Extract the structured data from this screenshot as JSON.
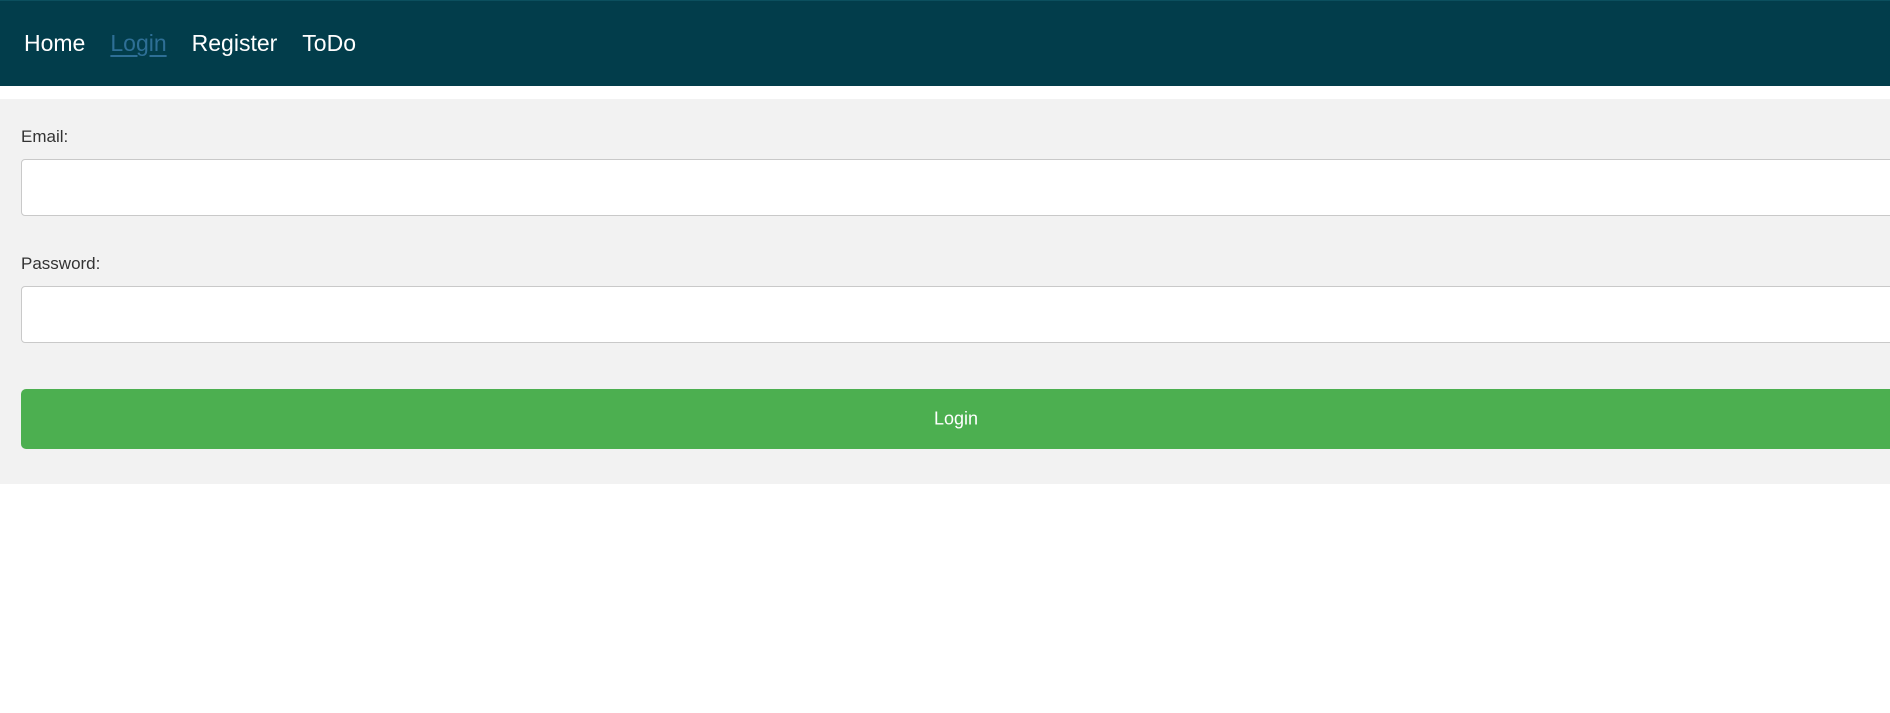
{
  "nav": {
    "items": [
      {
        "label": "Home",
        "active": false
      },
      {
        "label": "Login",
        "active": true
      },
      {
        "label": "Register",
        "active": false
      },
      {
        "label": "ToDo",
        "active": false
      }
    ]
  },
  "form": {
    "email_label": "Email:",
    "email_value": "",
    "password_label": "Password:",
    "password_value": "",
    "submit_label": "Login"
  },
  "colors": {
    "navbar_bg": "#023d4b",
    "active_link": "#2e6f96",
    "panel_bg": "#f2f2f2",
    "submit_bg": "#4caf50"
  }
}
